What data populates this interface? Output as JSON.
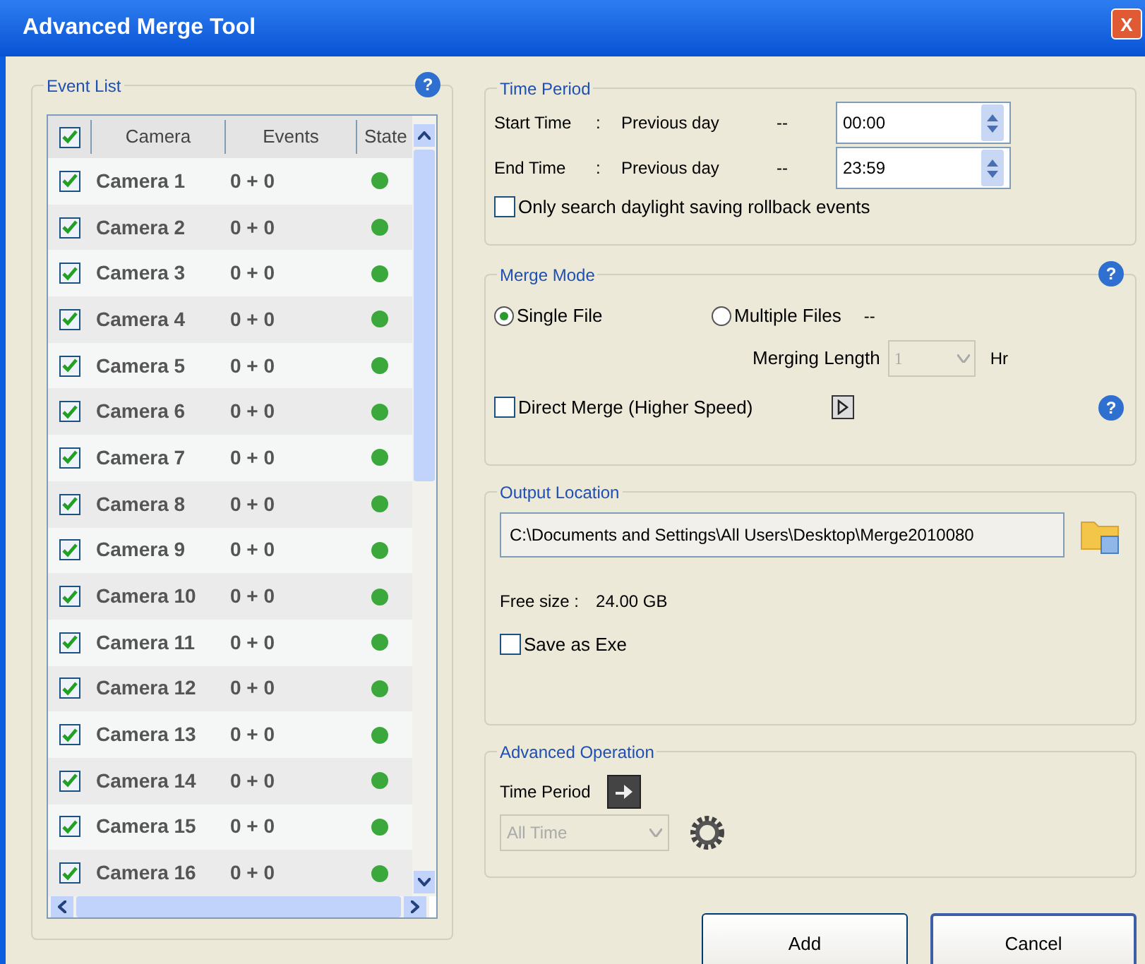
{
  "window": {
    "title": "Advanced Merge Tool",
    "close": "X"
  },
  "event_list": {
    "title": "Event List",
    "help": "?",
    "all_checked": true,
    "columns": [
      "Camera",
      "Events",
      "State"
    ],
    "rows": [
      {
        "camera": "Camera 1",
        "events": "0 + 0",
        "checked": true,
        "color": "#3aa83a"
      },
      {
        "camera": "Camera 2",
        "events": "0 + 0",
        "checked": true,
        "color": "#3aa83a"
      },
      {
        "camera": "Camera 3",
        "events": "0 + 0",
        "checked": true,
        "color": "#3aa83a"
      },
      {
        "camera": "Camera 4",
        "events": "0 + 0",
        "checked": true,
        "color": "#3aa83a"
      },
      {
        "camera": "Camera 5",
        "events": "0 + 0",
        "checked": true,
        "color": "#3aa83a"
      },
      {
        "camera": "Camera 6",
        "events": "0 + 0",
        "checked": true,
        "color": "#3aa83a"
      },
      {
        "camera": "Camera 7",
        "events": "0 + 0",
        "checked": true,
        "color": "#3aa83a"
      },
      {
        "camera": "Camera 8",
        "events": "0 + 0",
        "checked": true,
        "color": "#3aa83a"
      },
      {
        "camera": "Camera 9",
        "events": "0 + 0",
        "checked": true,
        "color": "#3aa83a"
      },
      {
        "camera": "Camera 10",
        "events": "0 + 0",
        "checked": true,
        "color": "#3aa83a"
      },
      {
        "camera": "Camera 11",
        "events": "0 + 0",
        "checked": true,
        "color": "#3aa83a"
      },
      {
        "camera": "Camera 12",
        "events": "0 + 0",
        "checked": true,
        "color": "#3aa83a"
      },
      {
        "camera": "Camera 13",
        "events": "0 + 0",
        "checked": true,
        "color": "#3aa83a"
      },
      {
        "camera": "Camera 14",
        "events": "0 + 0",
        "checked": true,
        "color": "#3aa83a"
      },
      {
        "camera": "Camera 15",
        "events": "0 + 0",
        "checked": true,
        "color": "#3aa83a"
      },
      {
        "camera": "Camera 16",
        "events": "0 + 0",
        "checked": true,
        "color": "#3aa83a"
      }
    ]
  },
  "time_period": {
    "title": "Time Period",
    "times": [
      {
        "label": "Start Time",
        "separator": ":",
        "day": "Previous day",
        "dash": "--",
        "value": "00:00"
      },
      {
        "label": "End Time",
        "separator": ":",
        "day": "Previous day",
        "dash": "--",
        "value": "23:59"
      }
    ],
    "daylight": {
      "label": "Only search daylight saving rollback events",
      "checked": false
    }
  },
  "merge_mode": {
    "title": "Merge Mode",
    "help": "?",
    "options": [
      {
        "label": "Single File",
        "selected": true
      },
      {
        "label": "Multiple Files",
        "selected": false
      }
    ],
    "dash": "--",
    "merging_length": {
      "label": "Merging Length",
      "value": "1",
      "unit": "Hr",
      "disabled": true
    },
    "direct_merge": {
      "label": "Direct Merge (Higher Speed)",
      "checked": false,
      "help": "?"
    }
  },
  "output_location": {
    "title": "Output Location",
    "path": "C:\\Documents and Settings\\All Users\\Desktop\\Merge2010080",
    "free_label": "Free size :",
    "free_value": "24.00 GB",
    "save_exe": {
      "label": "Save as Exe",
      "checked": false
    }
  },
  "advanced_operation": {
    "title": "Advanced Operation",
    "label": "Time Period",
    "select": {
      "value": "All Time",
      "disabled": true
    }
  },
  "buttons": [
    "Add",
    "Cancel"
  ]
}
